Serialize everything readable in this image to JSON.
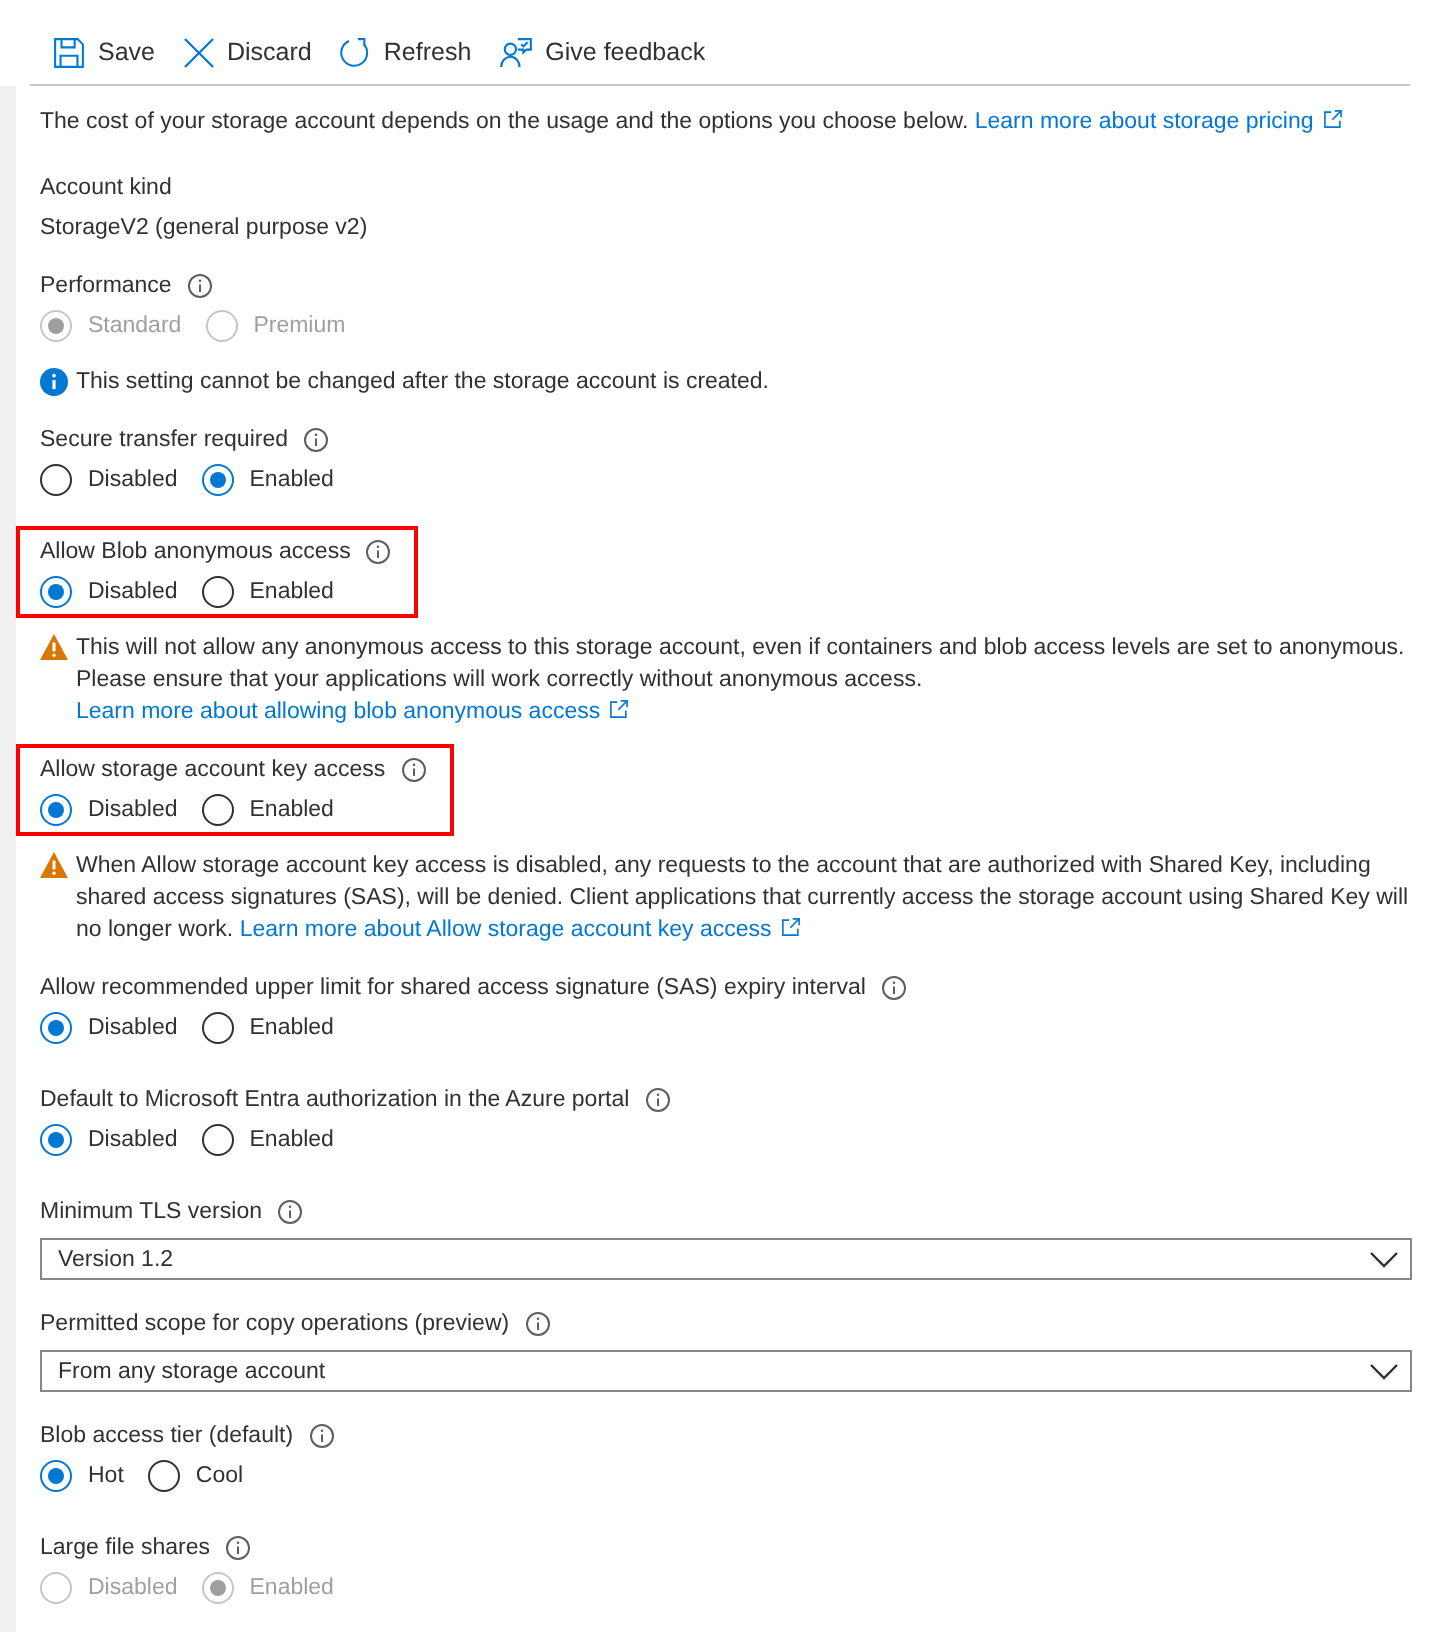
{
  "toolbar": [
    {
      "kind": "save",
      "label": "Save"
    },
    {
      "kind": "discard",
      "label": "Discard"
    },
    {
      "kind": "refresh",
      "label": "Refresh"
    },
    {
      "kind": "feedback",
      "label": "Give feedback"
    }
  ],
  "intro": {
    "text": "The cost of your storage account depends on the usage and the options you choose below.",
    "link": "Learn more about storage pricing"
  },
  "account_kind": {
    "label": "Account kind",
    "value": "StorageV2 (general purpose v2)"
  },
  "settings": [
    {
      "kind": "radio",
      "label": "Performance",
      "disabled": true,
      "highlighted": false,
      "options": [
        {
          "label": "Standard",
          "selected": true
        },
        {
          "label": "Premium",
          "selected": false
        }
      ],
      "note": {
        "kind": "info",
        "text": "This setting cannot be changed after the storage account is created."
      }
    },
    {
      "kind": "radio",
      "label": "Secure transfer required",
      "disabled": false,
      "highlighted": false,
      "options": [
        {
          "label": "Disabled",
          "selected": false
        },
        {
          "label": "Enabled",
          "selected": true
        }
      ]
    },
    {
      "kind": "radio",
      "label": "Allow Blob anonymous access",
      "disabled": false,
      "highlighted": true,
      "options": [
        {
          "label": "Disabled",
          "selected": true
        },
        {
          "label": "Enabled",
          "selected": false
        }
      ],
      "note": {
        "kind": "warning",
        "text": "This will not allow any anonymous access to this storage account, even if containers and blob access levels are set to anonymous. Please ensure that your applications will work correctly without anonymous access.",
        "link": "Learn more about allowing blob anonymous access"
      }
    },
    {
      "kind": "radio",
      "label": "Allow storage account key access",
      "disabled": false,
      "highlighted": true,
      "options": [
        {
          "label": "Disabled",
          "selected": true
        },
        {
          "label": "Enabled",
          "selected": false
        }
      ],
      "note": {
        "kind": "warning",
        "text": "When Allow storage account key access is disabled, any requests to the account that are authorized with Shared Key, including shared access signatures (SAS), will be denied. Client applications that currently access the storage account using Shared Key will no longer work.",
        "link": "Learn more about Allow storage account key access"
      }
    },
    {
      "kind": "radio",
      "label": "Allow recommended upper limit for shared access signature (SAS) expiry interval",
      "disabled": false,
      "highlighted": false,
      "options": [
        {
          "label": "Disabled",
          "selected": true
        },
        {
          "label": "Enabled",
          "selected": false
        }
      ]
    },
    {
      "kind": "radio",
      "label": "Default to Microsoft Entra authorization in the Azure portal",
      "disabled": false,
      "highlighted": false,
      "options": [
        {
          "label": "Disabled",
          "selected": true
        },
        {
          "label": "Enabled",
          "selected": false
        }
      ]
    },
    {
      "kind": "select",
      "label": "Minimum TLS version",
      "disabled": false,
      "highlighted": false,
      "value": "Version 1.2"
    },
    {
      "kind": "select",
      "label": "Permitted scope for copy operations (preview)",
      "disabled": false,
      "highlighted": false,
      "value": "From any storage account"
    },
    {
      "kind": "radio",
      "label": "Blob access tier (default)",
      "disabled": false,
      "highlighted": false,
      "options": [
        {
          "label": "Hot",
          "selected": true
        },
        {
          "label": "Cool",
          "selected": false
        }
      ]
    },
    {
      "kind": "radio",
      "label": "Large file shares",
      "disabled": true,
      "highlighted": false,
      "options": [
        {
          "label": "Disabled",
          "selected": false
        },
        {
          "label": "Enabled",
          "selected": true
        }
      ]
    }
  ]
}
